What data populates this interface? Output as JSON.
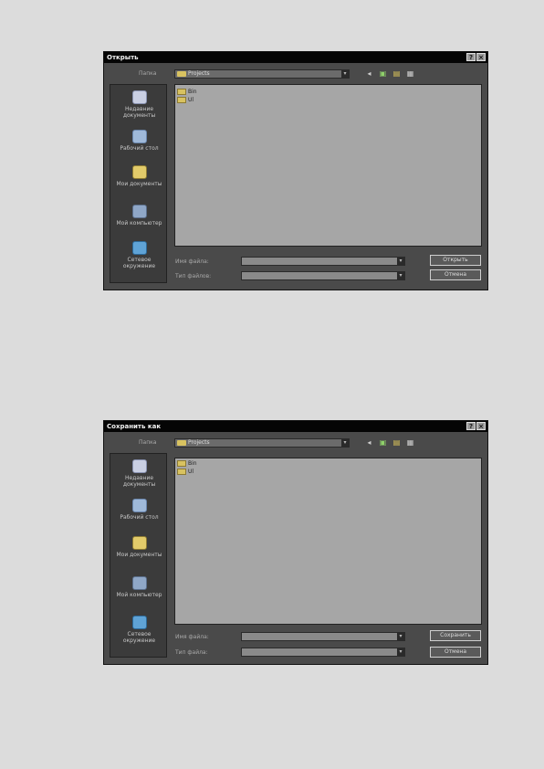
{
  "open_dialog": {
    "title": "Открыть",
    "help_label": "?",
    "close_label": "×",
    "look_in_label": "Папка",
    "current_folder": "Projects",
    "places": [
      {
        "label": "Недавние документы"
      },
      {
        "label": "Рабочий стол"
      },
      {
        "label": "Мои документы"
      },
      {
        "label": "Мой компьютер"
      },
      {
        "label": "Сетевое окружение"
      }
    ],
    "files": [
      {
        "name": "Bin"
      },
      {
        "name": "Ul"
      }
    ],
    "filename_label": "Имя файла:",
    "filetype_label": "Тип файлов:",
    "primary_button": "Открыть",
    "cancel_button": "Отмена"
  },
  "save_dialog": {
    "title": "Сохранить как",
    "help_label": "?",
    "close_label": "×",
    "look_in_label": "Папка",
    "current_folder": "Projects",
    "places": [
      {
        "label": "Недавние документы"
      },
      {
        "label": "Рабочий стол"
      },
      {
        "label": "Мои документы"
      },
      {
        "label": "Мой компьютер"
      },
      {
        "label": "Сетевое окружение"
      }
    ],
    "files": [
      {
        "name": "Bin"
      },
      {
        "name": "Ul"
      }
    ],
    "filename_label": "Имя файла:",
    "filetype_label": "Тип файла:",
    "primary_button": "Сохранить",
    "cancel_button": "Отмена"
  },
  "toolbar_icons": [
    "back-icon",
    "up-folder-icon",
    "new-folder-icon",
    "view-menu-icon"
  ],
  "colors": {
    "titlebar": "#050505",
    "dialog_bg": "#4a4a4a",
    "filelist_bg": "#a6a6a6",
    "page_bg": "#dcdcdc"
  }
}
